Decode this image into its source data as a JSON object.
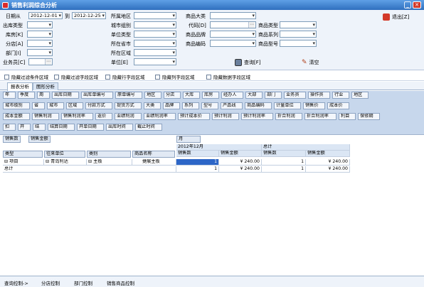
{
  "window": {
    "title": "销售利润综合分析",
    "min_label": "_",
    "close_label": "✕"
  },
  "filter": {
    "date_from_label": "日期从",
    "date_from": "2012-12-01",
    "date_to_label": "到",
    "date_to": "2012-12-25",
    "region_label": "所属地区",
    "product_category_label": "商品大类",
    "exit_label": "退出[Z]",
    "shipment_type_label": "出库类型",
    "city_group_label": "城市组别",
    "code_label": "代码[D]",
    "product_type_label": "商品类型",
    "warehouse_label": "库房[K]",
    "unit_type_label": "单位类型",
    "product_brand_label": "商品品牌",
    "product_series_label": "商品系列",
    "branch_label": "分店[A]",
    "province_label": "所在省市",
    "product_code_label": "商品编码",
    "product_model_label": "商品型号",
    "dept_label": "部门[I]",
    "area_label": "所在区域",
    "salesperson_label": "业务员[C]",
    "unit_label": "单位[E]",
    "query_label": "查询[F]",
    "clear_label": "清空"
  },
  "checkboxes": [
    "隐藏过滤条件区域",
    "隐藏过滤字段区域",
    "隐藏行字段区域",
    "隐藏列字段区域",
    "隐藏数据字段区域"
  ],
  "tabs": [
    "报表分析",
    "图形分析"
  ],
  "field_rows": [
    [
      "年",
      "季度",
      "周",
      "出库日期",
      "出库单编号",
      "原单编号",
      "地区",
      "分店",
      "大库",
      "库房",
      "经办人",
      "大部",
      "部门",
      "业务员",
      "操作员",
      "行业",
      "地区"
    ],
    [
      "城市级别",
      "省",
      "城市",
      "区域",
      "付款方式",
      "提货方式",
      "大类",
      "品牌",
      "系列",
      "型号",
      "产品线",
      "商品编码",
      "计量单位",
      "销售价",
      "成本价"
    ],
    [
      "成本金额",
      "销售利润",
      "销售利润率",
      "返价",
      "业绩利润",
      "业绩利润率",
      "预计成本价",
      "预计利润",
      "预计利润率",
      "折合利润",
      "折合利润率",
      "利目",
      "保修期"
    ],
    [
      "扣",
      "开",
      "结",
      "结算日期",
      "开单日期",
      "出库时间",
      "截止时间"
    ]
  ],
  "pivot": {
    "filter_fields": [
      "销售数",
      "销售金额"
    ],
    "column_field": "月",
    "row_fields": [
      "类型",
      "往来单位",
      "类别",
      "商品名称"
    ],
    "col_month": "2012年12月",
    "col_total": "总计",
    "data_headers": [
      "销售数",
      "销售金额",
      "销售数",
      "销售金额"
    ],
    "rows": [
      {
        "type": "项目",
        "customer": "青岛利达",
        "category": "主板",
        "product": "捷展主板",
        "v1": "1",
        "v2": "¥ 240.00",
        "v3": "1",
        "v4": "¥ 240.00"
      }
    ],
    "total_label": "总计",
    "total": {
      "v1": "1",
      "v2": "¥ 240.00",
      "v3": "1",
      "v4": "¥ 240.00"
    }
  },
  "status": [
    "查询控制->",
    "分店控制",
    "部门控制",
    "销售商品控制"
  ]
}
